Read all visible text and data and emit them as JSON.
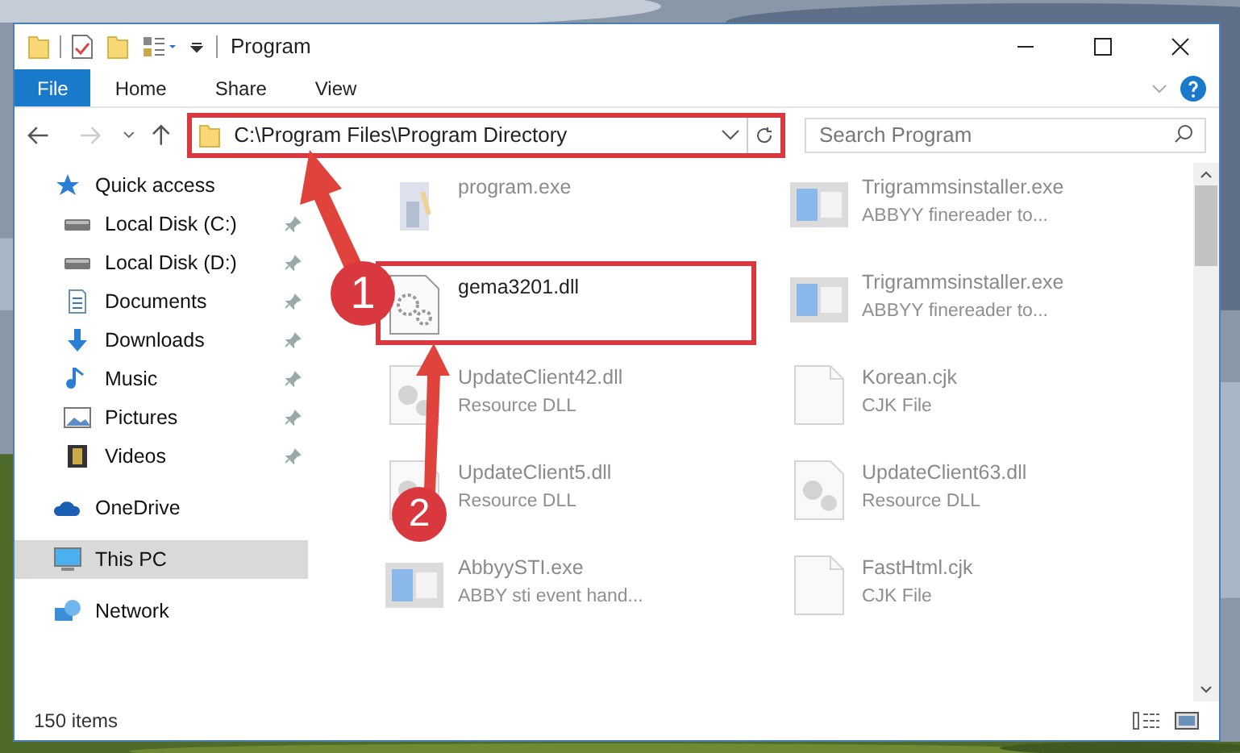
{
  "window": {
    "title": "Program"
  },
  "ribbon_tabs": [
    {
      "label": "File",
      "selected": true
    },
    {
      "label": "Home",
      "selected": false
    },
    {
      "label": "Share",
      "selected": false
    },
    {
      "label": "View",
      "selected": false
    }
  ],
  "address": {
    "path": "C:\\Program Files\\Program Directory",
    "highlighted": true
  },
  "search": {
    "placeholder": "Search Program"
  },
  "sidebar": {
    "items": [
      {
        "label": "Quick access",
        "kind": "star",
        "selected": false,
        "children": [
          {
            "label": "Local Disk (C:)",
            "kind": "drive",
            "pinned": true,
            "selected": false
          },
          {
            "label": "Local Disk (D:)",
            "kind": "drive",
            "pinned": true,
            "selected": false
          },
          {
            "label": "Documents",
            "kind": "document",
            "pinned": true,
            "selected": false
          },
          {
            "label": "Downloads",
            "kind": "download",
            "pinned": true,
            "selected": false
          },
          {
            "label": "Music",
            "kind": "music",
            "pinned": true,
            "selected": false
          },
          {
            "label": "Pictures",
            "kind": "pictures",
            "pinned": true,
            "selected": false
          },
          {
            "label": "Videos",
            "kind": "video",
            "pinned": true,
            "selected": false
          }
        ]
      },
      {
        "label": "OneDrive",
        "kind": "cloud",
        "selected": false
      },
      {
        "label": "This PC",
        "kind": "pc",
        "selected": true
      },
      {
        "label": "Network",
        "kind": "network",
        "selected": false
      }
    ]
  },
  "files": [
    {
      "name": "program.exe",
      "kind": "exe",
      "dimmed": true,
      "highlighted": false
    },
    {
      "name": "Trigrammsinstaller.exe",
      "detail": "ABBYY finereader to...",
      "kind": "installer",
      "dimmed": true,
      "highlighted": false
    },
    {
      "name": "gema3201.dll",
      "kind": "gear",
      "dimmed": false,
      "highlighted": true
    },
    {
      "name": "Trigrammsinstaller.exe",
      "detail": "ABBYY finereader to...",
      "kind": "installer",
      "dimmed": true,
      "highlighted": false
    },
    {
      "name": "UpdateClient42.dll",
      "detail": "Resource DLL",
      "kind": "dll",
      "dimmed": true,
      "highlighted": false
    },
    {
      "name": "Korean.cjk",
      "detail": "CJK File",
      "kind": "blank",
      "dimmed": true,
      "highlighted": false
    },
    {
      "name": "UpdateClient5.dll",
      "detail": "Resource DLL",
      "kind": "dll",
      "dimmed": true,
      "highlighted": false
    },
    {
      "name": "UpdateClient63.dll",
      "detail": "Resource DLL",
      "kind": "dll",
      "dimmed": true,
      "highlighted": false
    },
    {
      "name": "AbbyySTI.exe",
      "detail": "ABBY sti event hand...",
      "kind": "installer",
      "dimmed": true,
      "highlighted": false
    },
    {
      "name": "FastHtml.cjk",
      "detail": "CJK File",
      "kind": "blank",
      "dimmed": true,
      "highlighted": false
    }
  ],
  "status_bar": {
    "count": "150 items"
  },
  "callouts": [
    {
      "label": "1"
    },
    {
      "label": "2"
    }
  ]
}
